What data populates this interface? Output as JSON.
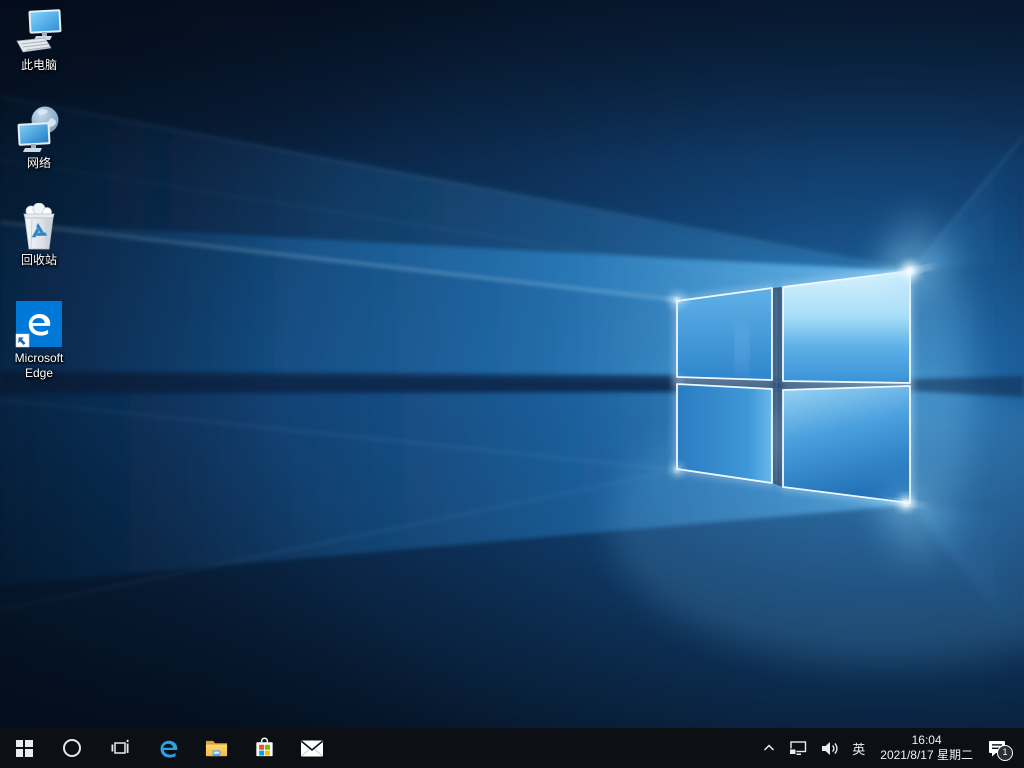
{
  "desktop": {
    "icons": [
      {
        "id": "this-pc",
        "icon": "computer-monitor-keyboard-icon",
        "label": "此电脑"
      },
      {
        "id": "network",
        "icon": "globe-monitor-icon",
        "label": "网络"
      },
      {
        "id": "recycle-bin",
        "icon": "recycle-bin-icon",
        "label": "回收站"
      },
      {
        "id": "microsoft-edge",
        "icon": "edge-shortcut-tile-icon",
        "label": "Microsoft Edge"
      }
    ]
  },
  "taskbar": {
    "buttons": [
      {
        "id": "start",
        "icon": "windows-logo-icon"
      },
      {
        "id": "cortana",
        "icon": "cortana-circle-icon"
      },
      {
        "id": "task-view",
        "icon": "task-view-icon"
      },
      {
        "id": "edge",
        "icon": "edge-e-icon"
      },
      {
        "id": "file-explorer",
        "icon": "folder-icon"
      },
      {
        "id": "store",
        "icon": "store-bag-icon"
      },
      {
        "id": "mail",
        "icon": "mail-envelope-icon"
      }
    ],
    "tray": {
      "hidden_icons_chevron": "chevron-up-icon",
      "network_icon": "ethernet-monitor-icon",
      "volume_icon": "speaker-icon",
      "language": "英",
      "time": "16:04",
      "date": "2021/8/17 星期二",
      "action_center_icon": "notification-icon",
      "notification_count": "1"
    }
  },
  "colors": {
    "taskbar_bg": "#0c0f14",
    "edge_blue": "#0078d7",
    "wallpaper_deep_navy": "#051427",
    "wallpaper_accent_blue": "#2f8fd6",
    "store_red": "#f25022",
    "store_green": "#7fba00",
    "store_blue": "#00a4ef",
    "store_yellow": "#ffb900"
  }
}
